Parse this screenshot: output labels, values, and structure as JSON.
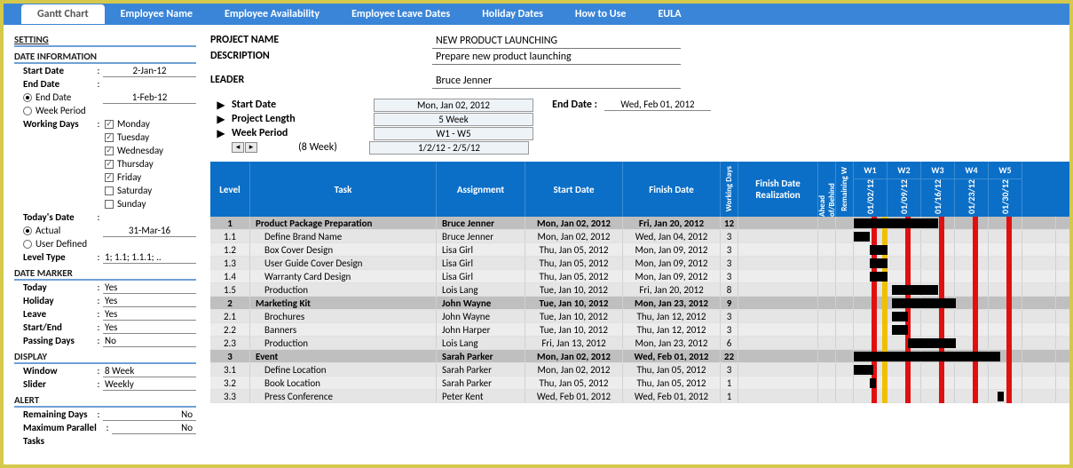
{
  "tabs": [
    "Gantt Chart",
    "Employee Name",
    "Employee Availability",
    "Employee Leave Dates",
    "Holiday Dates",
    "How to Use",
    "EULA"
  ],
  "sidebar": {
    "setting": "SETTING",
    "dateinfo": "DATE INFORMATION",
    "start_date": "Start Date",
    "start_date_v": "2-Jan-12",
    "end_date": "End Date",
    "end_date_opt": "End Date",
    "end_date_v": "1-Feb-12",
    "week_period_opt": "Week Period",
    "working_days": "Working Days",
    "days": [
      "Monday",
      "Tuesday",
      "Wednesday",
      "Thursday",
      "Friday",
      "Saturday",
      "Sunday"
    ],
    "todays_date": "Today's Date",
    "actual": "Actual",
    "actual_v": "31-Mar-16",
    "user_defined": "User Defined",
    "level_type": "Level Type",
    "level_type_v": "1; 1.1; 1.1.1; ..",
    "date_marker": "DATE MARKER",
    "today": "Today",
    "today_v": "Yes",
    "holiday": "Holiday",
    "holiday_v": "Yes",
    "leave": "Leave",
    "leave_v": "Yes",
    "startend": "Start/End",
    "startend_v": "Yes",
    "passing": "Passing Days",
    "passing_v": "No",
    "display": "DISPLAY",
    "window": "Window",
    "window_v": "8 Week",
    "slider": "Slider",
    "slider_v": "Weekly",
    "alert": "ALERT",
    "remaining": "Remaining Days",
    "remaining_v": "No",
    "maxpar": "Maximum Parallel",
    "maxpar_v": "No",
    "tasks": "Tasks"
  },
  "proj": {
    "name_lbl": "PROJECT NAME",
    "name_v": "NEW PRODUCT LAUNCHING",
    "desc_lbl": "DESCRIPTION",
    "desc_v": "Prepare new product launching",
    "leader_lbl": "LEADER",
    "leader_v": "Bruce Jenner",
    "sd_lbl": "Start Date",
    "sd_v": "Mon, Jan 02, 2012",
    "ed_lbl": "End Date :",
    "ed_v": "Wed, Feb 01, 2012",
    "pl_lbl": "Project Length",
    "pl_v": "5 Week",
    "wp_lbl": "Week Period",
    "wp_v": "W1 - W5",
    "spin_lbl": "(8 Week)",
    "spin_v": "1/2/12 - 2/5/12"
  },
  "headers": {
    "level": "Level",
    "task": "Task",
    "assign": "Assignment",
    "start": "Start Date",
    "finish": "Finish Date",
    "wd": "Working Days",
    "fr": "Finish Date Realization",
    "ab": "Ahead of/Behind",
    "rw": "Remaining W"
  },
  "weeks": [
    {
      "w": "W1",
      "d": "01/02/12"
    },
    {
      "w": "W2",
      "d": "01/09/12"
    },
    {
      "w": "W3",
      "d": "01/16/12"
    },
    {
      "w": "W4",
      "d": "01/23/12"
    },
    {
      "w": "W5",
      "d": "01/30/12"
    }
  ],
  "rows": [
    {
      "lv": "1",
      "task": "Product Package Preparation",
      "asg": "Bruce Jenner",
      "sd": "Mon, Jan 02, 2012",
      "fd": "Fri, Jan 20, 2012",
      "wd": "12",
      "sum": true,
      "b": [
        0,
        95
      ]
    },
    {
      "lv": "1.1",
      "task": "Define Brand Name",
      "asg": "Bruce Jenner",
      "sd": "Mon, Jan 02, 2012",
      "fd": "Wed, Jan 04, 2012",
      "wd": "3",
      "b": [
        0,
        18
      ]
    },
    {
      "lv": "1.2",
      "task": "Box Cover Design",
      "asg": "Lisa Girl",
      "sd": "Thu, Jan 05, 2012",
      "fd": "Mon, Jan 09, 2012",
      "wd": "3",
      "b": [
        18,
        20
      ]
    },
    {
      "lv": "1.3",
      "task": "User Guide Cover Design",
      "asg": "Lisa Girl",
      "sd": "Thu, Jan 05, 2012",
      "fd": "Mon, Jan 09, 2012",
      "wd": "3",
      "b": [
        18,
        20
      ]
    },
    {
      "lv": "1.4",
      "task": "Warranty Card Design",
      "asg": "Lisa Girl",
      "sd": "Thu, Jan 05, 2012",
      "fd": "Mon, Jan 09, 2012",
      "wd": "3",
      "b": [
        18,
        20
      ]
    },
    {
      "lv": "1.5",
      "task": "Production",
      "asg": "Lois Lang",
      "sd": "Tue, Jan 10, 2012",
      "fd": "Fri, Jan 20, 2012",
      "wd": "8",
      "b": [
        43,
        52
      ]
    },
    {
      "lv": "2",
      "task": "Marketing Kit",
      "asg": "John Wayne",
      "sd": "Tue, Jan 10, 2012",
      "fd": "Mon, Jan 23, 2012",
      "wd": "9",
      "sum": true,
      "b": [
        43,
        72
      ]
    },
    {
      "lv": "2.1",
      "task": "Brochures",
      "asg": "John Wayne",
      "sd": "Tue, Jan 10, 2012",
      "fd": "Thu, Jan 12, 2012",
      "wd": "3",
      "b": [
        43,
        18
      ]
    },
    {
      "lv": "2.2",
      "task": "Banners",
      "asg": "John Harper",
      "sd": "Tue, Jan 10, 2012",
      "fd": "Thu, Jan 12, 2012",
      "wd": "3",
      "b": [
        43,
        18
      ]
    },
    {
      "lv": "2.3",
      "task": "Production",
      "asg": "Lois Lang",
      "sd": "Fri, Jan 13, 2012",
      "fd": "Mon, Jan 23, 2012",
      "wd": "6",
      "b": [
        61,
        54
      ]
    },
    {
      "lv": "3",
      "task": "Event",
      "asg": "Sarah Parker",
      "sd": "Mon, Jan 02, 2012",
      "fd": "Wed, Feb 01, 2012",
      "wd": "22",
      "sum": true,
      "b": [
        0,
        165
      ]
    },
    {
      "lv": "3.1",
      "task": "Define Location",
      "asg": "Sarah Parker",
      "sd": "Mon, Jan 02, 2012",
      "fd": "Thu, Jan 05, 2012",
      "wd": "3",
      "b": [
        0,
        22
      ]
    },
    {
      "lv": "3.2",
      "task": "Book Location",
      "asg": "Sarah Parker",
      "sd": "Thu, Jan 05, 2012",
      "fd": "Thu, Jan 05, 2012",
      "wd": "1",
      "b": [
        18,
        7
      ]
    },
    {
      "lv": "3.3",
      "task": "Press Conference",
      "asg": "Peter Kent",
      "sd": "Wed, Feb 01, 2012",
      "fd": "Wed, Feb 01, 2012",
      "wd": "1",
      "b": [
        162,
        7
      ]
    }
  ]
}
